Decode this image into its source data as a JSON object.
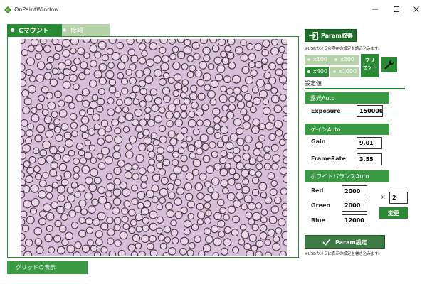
{
  "window": {
    "title": "OnPaintWindow"
  },
  "tabs": [
    {
      "label": "Cマウント",
      "selected": true
    },
    {
      "label": "接眼",
      "selected": false
    }
  ],
  "grid_button": {
    "label": "グリッドの表示"
  },
  "camera": {
    "param_get_label": "Param取得",
    "param_get_note": "※USBカメラの現在の設定を読み込みます。",
    "magnifications": [
      {
        "label": "x100",
        "selected": false
      },
      {
        "label": "x200",
        "selected": false
      },
      {
        "label": "x400",
        "selected": true
      },
      {
        "label": "x1000",
        "selected": false
      }
    ],
    "preset_label_line1": "プリ",
    "preset_label_line2": "セット",
    "settings_title": "設定値",
    "exposure": {
      "header": "露光Auto",
      "label": "Exposure",
      "value": "150000.0"
    },
    "gain": {
      "header": "ゲインAuto",
      "gain_label": "Gain",
      "gain_value": "9.01",
      "framerate_label": "FrameRate",
      "framerate_value": "3.55"
    },
    "white_balance": {
      "header": "ホワイトバランスAuto",
      "red_label": "Red",
      "red_value": "2000",
      "green_label": "Green",
      "green_value": "2000",
      "blue_label": "Blue",
      "blue_value": "12000",
      "times_symbol": "×",
      "multiplier_value": "2",
      "change_label": "変更"
    },
    "param_set_label": "Param設定",
    "param_set_note": "※USBカメラに表示の設定を書き込みます。"
  },
  "colors": {
    "accent": "#2b8a35",
    "accent_light": "#b5d2a9",
    "specimen_bg": "#d8bfd9",
    "cell_ring": "#4a3346"
  },
  "icons": {
    "app": "app-diamond-icon",
    "import": "import-arrow-icon",
    "wrench": "wrench-icon",
    "check": "check-icon",
    "minimize": "minimize-icon",
    "maximize": "maximize-icon",
    "close": "close-icon"
  }
}
